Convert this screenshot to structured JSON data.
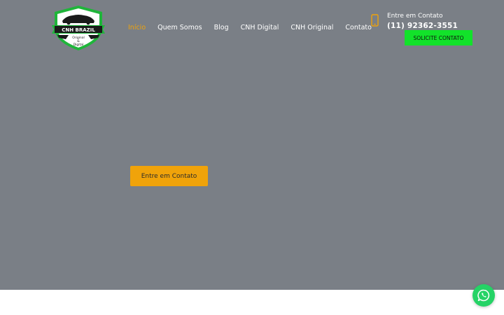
{
  "logo": {
    "brand": "CNH BRAZIL",
    "tagline_line1": "Original",
    "tagline_line2": "&",
    "tagline_line3": "Digital",
    "colors": {
      "green": "#1fb53a",
      "black": "#1a1a1a"
    }
  },
  "nav": {
    "items": [
      {
        "label": "Início",
        "active": true
      },
      {
        "label": "Quem Somos",
        "active": false
      },
      {
        "label": "Blog",
        "active": false
      },
      {
        "label": "CNH Digital",
        "active": false
      },
      {
        "label": "CNH Original",
        "active": false
      },
      {
        "label": "Contato",
        "active": false
      }
    ],
    "active_color": "#f0a30a"
  },
  "header_contact": {
    "icon": "phone-icon",
    "label": "Entre em Contato",
    "phone": "(11) 92362-3551",
    "button_label": "SOLICITE CONTATO",
    "button_color": "#12e22a"
  },
  "hero": {
    "background_color": "#7a7f86",
    "cta_label": "Entre em Contato",
    "cta_color": "#f0a30a"
  },
  "floating": {
    "icon": "whatsapp-icon",
    "color": "#25d366"
  }
}
